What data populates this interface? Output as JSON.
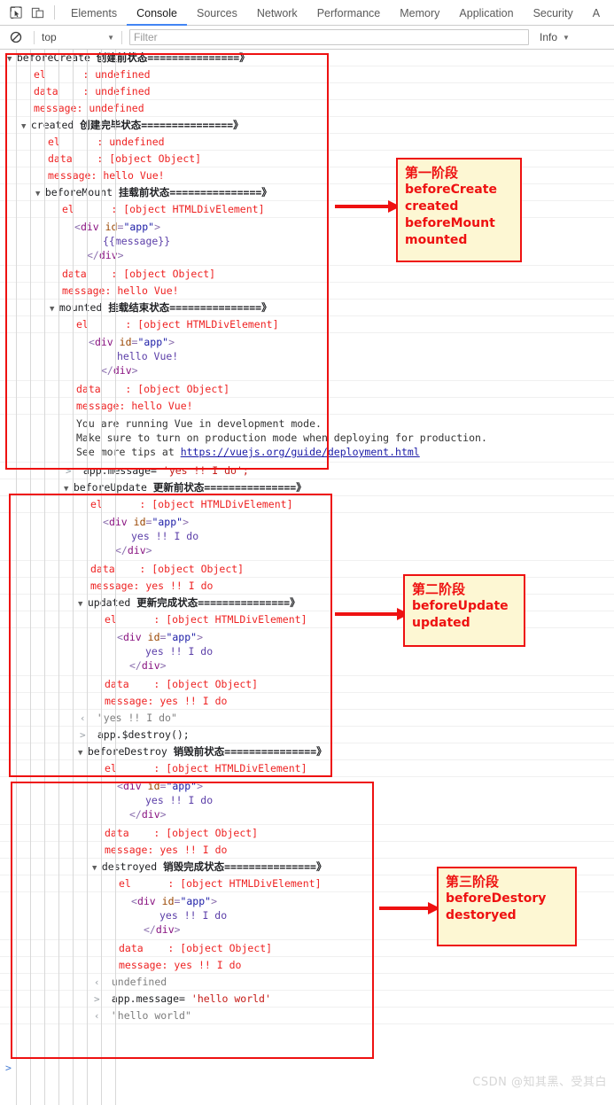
{
  "tabbar": {
    "inspect_icon": "inspect-cursor-icon",
    "device_icon": "device-toolbar-icon",
    "tabs": [
      {
        "label": "Elements",
        "active": false
      },
      {
        "label": "Console",
        "active": true
      },
      {
        "label": "Sources",
        "active": false
      },
      {
        "label": "Network",
        "active": false
      },
      {
        "label": "Performance",
        "active": false
      },
      {
        "label": "Memory",
        "active": false
      },
      {
        "label": "Application",
        "active": false
      },
      {
        "label": "Security",
        "active": false
      },
      {
        "label": "A",
        "active": false
      }
    ]
  },
  "filterbar": {
    "clear_icon": "clear-console-icon",
    "context": "top",
    "filter_placeholder": "Filter",
    "filter_value": "",
    "level": "Info",
    "caret": "▼"
  },
  "console": {
    "rows": [
      {
        "i": 0,
        "g": 0,
        "t": "group",
        "tri": "▼",
        "name": "beforeCreate",
        "cn": "创建前状态===============》"
      },
      {
        "i": 1,
        "g": 1,
        "t": "prop",
        "key": "el      ",
        "val": "undefined"
      },
      {
        "i": 2,
        "g": 1,
        "t": "prop",
        "key": "data    ",
        "val": "undefined"
      },
      {
        "i": 3,
        "g": 1,
        "t": "prop",
        "key": "message:",
        "val": "undefined",
        "nocolon": true
      },
      {
        "i": 4,
        "g": 1,
        "t": "group",
        "tri": "▼",
        "name": "created",
        "cn": "创建完毕状态===============》"
      },
      {
        "i": 5,
        "g": 2,
        "t": "prop",
        "key": "el      ",
        "val": "undefined"
      },
      {
        "i": 6,
        "g": 2,
        "t": "prop",
        "key": "data    ",
        "val": "[object Object]"
      },
      {
        "i": 7,
        "g": 2,
        "t": "prop",
        "key": "message:",
        "val": "hello Vue!",
        "nocolon": true
      },
      {
        "i": 8,
        "g": 2,
        "t": "group",
        "tri": "▼",
        "name": "beforeMount",
        "cn": "挂载前状态===============》"
      },
      {
        "i": 9,
        "g": 3,
        "t": "prop",
        "key": "el      ",
        "val": "[object HTMLDivElement]"
      },
      {
        "i": 10,
        "g": 3,
        "t": "html",
        "tag": "div",
        "attr": "id",
        "attrval": "\"app\"",
        "text": "{{message}}"
      },
      {
        "i": 11,
        "g": 3,
        "t": "prop",
        "key": "data    ",
        "val": "[object Object]"
      },
      {
        "i": 12,
        "g": 3,
        "t": "prop",
        "key": "message:",
        "val": "hello Vue!",
        "nocolon": true
      },
      {
        "i": 13,
        "g": 3,
        "t": "group",
        "tri": "▼",
        "name": "mounted",
        "cn": "挂载结束状态===============》"
      },
      {
        "i": 14,
        "g": 4,
        "t": "prop",
        "key": "el      ",
        "val": "[object HTMLDivElement]"
      },
      {
        "i": 15,
        "g": 4,
        "t": "html",
        "tag": "div",
        "attr": "id",
        "attrval": "\"app\"",
        "text": "hello Vue!"
      },
      {
        "i": 16,
        "g": 4,
        "t": "prop",
        "key": "data    ",
        "val": "[object Object]"
      },
      {
        "i": 17,
        "g": 4,
        "t": "prop",
        "key": "message:",
        "val": "hello Vue!",
        "nocolon": true
      },
      {
        "i": 18,
        "g": 4,
        "t": "warn",
        "lines": [
          "You are running Vue in development mode.",
          "Make sure to turn on production mode when deploying for production.",
          "See more tips at "
        ],
        "link": "https://vuejs.org/guide/deployment.html"
      },
      {
        "i": 19,
        "g": 4,
        "t": "input",
        "marker": ">",
        "code": "app.message= ",
        "str": "'yes !! I do';"
      },
      {
        "i": 20,
        "g": 4,
        "t": "group",
        "tri": "▼",
        "name": "beforeUpdate",
        "cn": "更新前状态===============》"
      },
      {
        "i": 21,
        "g": 5,
        "t": "prop",
        "key": "el      ",
        "val": "[object HTMLDivElement]"
      },
      {
        "i": 22,
        "g": 5,
        "t": "html",
        "tag": "div",
        "attr": "id",
        "attrval": "\"app\"",
        "text": "yes !! I do"
      },
      {
        "i": 23,
        "g": 5,
        "t": "prop",
        "key": "data    ",
        "val": "[object Object]"
      },
      {
        "i": 24,
        "g": 5,
        "t": "prop",
        "key": "message:",
        "val": "yes !! I do",
        "nocolon": true
      },
      {
        "i": 25,
        "g": 5,
        "t": "group",
        "tri": "▼",
        "name": "updated",
        "cn": "更新完成状态===============》"
      },
      {
        "i": 26,
        "g": 6,
        "t": "prop",
        "key": "el      ",
        "val": "[object HTMLDivElement]"
      },
      {
        "i": 27,
        "g": 6,
        "t": "html",
        "tag": "div",
        "attr": "id",
        "attrval": "\"app\"",
        "text": "yes !! I do"
      },
      {
        "i": 28,
        "g": 6,
        "t": "prop",
        "key": "data    ",
        "val": "[object Object]"
      },
      {
        "i": 29,
        "g": 6,
        "t": "prop",
        "key": "message:",
        "val": "yes !! I do",
        "nocolon": true
      },
      {
        "i": 30,
        "g": 5,
        "t": "output",
        "marker": "‹",
        "val": "\"yes !! I do\""
      },
      {
        "i": 31,
        "g": 5,
        "t": "input",
        "marker": ">",
        "code": "app.$destroy();",
        "str": ""
      },
      {
        "i": 32,
        "g": 5,
        "t": "group",
        "tri": "▼",
        "name": "beforeDestroy",
        "cn": "销毁前状态===============》"
      },
      {
        "i": 33,
        "g": 6,
        "t": "prop",
        "key": "el      ",
        "val": "[object HTMLDivElement]"
      },
      {
        "i": 34,
        "g": 6,
        "t": "html",
        "tag": "div",
        "attr": "id",
        "attrval": "\"app\"",
        "text": "yes !! I do"
      },
      {
        "i": 35,
        "g": 6,
        "t": "prop",
        "key": "data    ",
        "val": "[object Object]"
      },
      {
        "i": 36,
        "g": 6,
        "t": "prop",
        "key": "message:",
        "val": "yes !! I do",
        "nocolon": true
      },
      {
        "i": 37,
        "g": 6,
        "t": "group",
        "tri": "▼",
        "name": "destroyed",
        "cn": "销毁完成状态===============》"
      },
      {
        "i": 38,
        "g": 7,
        "t": "prop",
        "key": "el      ",
        "val": "[object HTMLDivElement]"
      },
      {
        "i": 39,
        "g": 7,
        "t": "html",
        "tag": "div",
        "attr": "id",
        "attrval": "\"app\"",
        "text": "yes !! I do"
      },
      {
        "i": 40,
        "g": 7,
        "t": "prop",
        "key": "data    ",
        "val": "[object Object]"
      },
      {
        "i": 41,
        "g": 7,
        "t": "prop",
        "key": "message:",
        "val": "yes !! I do",
        "nocolon": true
      },
      {
        "i": 42,
        "g": 6,
        "t": "output",
        "marker": "‹",
        "val": "undefined"
      },
      {
        "i": 43,
        "g": 6,
        "t": "input",
        "marker": ">",
        "code": "app.message= ",
        "str": "'hello world'"
      },
      {
        "i": 44,
        "g": 6,
        "t": "output",
        "marker": "‹",
        "val": "\"hello world\""
      }
    ],
    "prompt": ">"
  },
  "annotations": {
    "notes": [
      {
        "id": "stage-1",
        "cn": "第一阶段",
        "lines": [
          "beforeCreate",
          "created",
          "beforeMount",
          "mounted"
        ]
      },
      {
        "id": "stage-2",
        "cn": "第二阶段",
        "lines": [
          "beforeUpdate",
          "updated"
        ]
      },
      {
        "id": "stage-3",
        "cn": "第三阶段",
        "lines": [
          "beforeDestory",
          "destoryed"
        ]
      }
    ],
    "box_color": "#ee1111",
    "note_bg": "#fdf7d3"
  },
  "watermark": "CSDN @知其黑、受其白"
}
